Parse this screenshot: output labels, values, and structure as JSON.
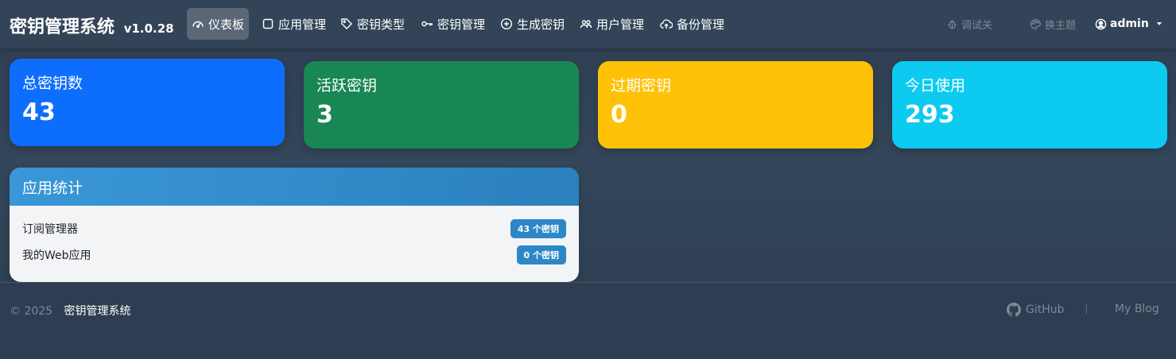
{
  "navbar": {
    "brand": "密钥管理系统",
    "version": "v1.0.28",
    "items": [
      {
        "label": "仪表板",
        "icon": "speedometer-icon",
        "active": true
      },
      {
        "label": "应用管理",
        "icon": "square-icon"
      },
      {
        "label": "密钥类型",
        "icon": "tag-icon"
      },
      {
        "label": "密钥管理",
        "icon": "key-icon"
      },
      {
        "label": "生成密钥",
        "icon": "plus-circle-icon"
      },
      {
        "label": "用户管理",
        "icon": "people-icon"
      },
      {
        "label": "备份管理",
        "icon": "cloud-upload-icon"
      }
    ],
    "debug_label": "调试关",
    "theme_label": "换主题",
    "user": "admin"
  },
  "stats": [
    {
      "title": "总密钥数",
      "value": "43",
      "color": "#0d6efd"
    },
    {
      "title": "活跃密钥",
      "value": "3",
      "color": "#198754"
    },
    {
      "title": "过期密钥",
      "value": "0",
      "color": "#ffc107"
    },
    {
      "title": "今日使用",
      "value": "293",
      "color": "#0dcaf0"
    }
  ],
  "app_stats": {
    "title": "应用统计",
    "apps": [
      {
        "name": "订阅管理器",
        "badge": "43 个密钥"
      },
      {
        "name": "我的Web应用",
        "badge": "0 个密钥"
      }
    ]
  },
  "footer": {
    "copyright": "© 2025",
    "site_name": "密钥管理系统",
    "links": [
      {
        "label": "GitHub",
        "icon": "github-icon"
      },
      {
        "label": "My Blog"
      }
    ],
    "separator": "|"
  }
}
